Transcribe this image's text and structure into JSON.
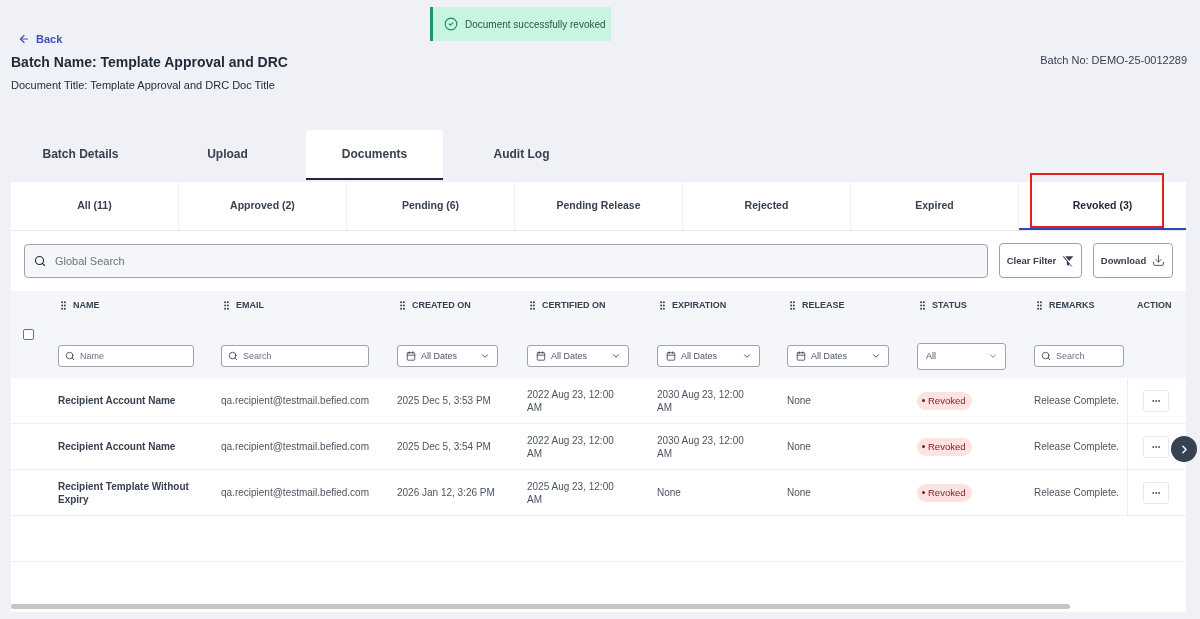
{
  "toast": {
    "message": "Document successfully revoked"
  },
  "header": {
    "back_link": "Back",
    "batch_name": "Batch Name: Template Approval and DRC",
    "document_title": "Document Title: Template Approval and DRC Doc Title",
    "batch_no": "Batch No: DEMO-25-0012289"
  },
  "main_tabs": [
    {
      "label": "Batch Details",
      "selected": false
    },
    {
      "label": "Upload",
      "selected": false
    },
    {
      "label": "Documents",
      "selected": true
    },
    {
      "label": "Audit Log",
      "selected": false
    }
  ],
  "status_tabs": [
    {
      "label": "All (11)",
      "selected": false,
      "outlined": false
    },
    {
      "label": "Approved (2)",
      "selected": false,
      "outlined": false
    },
    {
      "label": "Pending (6)",
      "selected": false,
      "outlined": false
    },
    {
      "label": "Pending Release",
      "selected": false,
      "outlined": false
    },
    {
      "label": "Rejected",
      "selected": false,
      "outlined": false
    },
    {
      "label": "Expired",
      "selected": false,
      "outlined": false
    },
    {
      "label": "Revoked (3)",
      "selected": true,
      "outlined": true
    }
  ],
  "toolbar": {
    "search": {
      "placeholder": "Global Search"
    },
    "buttons": [
      {
        "label": "Clear Filter",
        "kind": "clear_filter"
      },
      {
        "label": "Download",
        "kind": "download"
      }
    ]
  },
  "table": {
    "select_all": {
      "checked": false
    },
    "columns": [
      {
        "label": "NAME",
        "draggable": true,
        "filter": {
          "kind": "search",
          "placeholder": "Name"
        }
      },
      {
        "label": "EMAIL",
        "draggable": true,
        "filter": {
          "kind": "search",
          "placeholder": "Search"
        }
      },
      {
        "label": "CREATED ON",
        "draggable": true,
        "filter": {
          "kind": "date",
          "value": "All Dates"
        }
      },
      {
        "label": "CERTIFIED ON",
        "draggable": true,
        "filter": {
          "kind": "date",
          "value": "All Dates"
        }
      },
      {
        "label": "EXPIRATION",
        "draggable": true,
        "filter": {
          "kind": "date",
          "value": "All Dates"
        }
      },
      {
        "label": "RELEASE",
        "draggable": true,
        "filter": {
          "kind": "date",
          "value": "All Dates"
        }
      },
      {
        "label": "STATUS",
        "draggable": true,
        "filter": {
          "kind": "select",
          "value": "All"
        }
      },
      {
        "label": "REMARKS",
        "draggable": true,
        "filter": {
          "kind": "search",
          "placeholder": "Search"
        }
      },
      {
        "label": "ACTION",
        "draggable": false
      }
    ],
    "rows": [
      {
        "name": "Recipient Account Name",
        "email": "qa.recipient@testmail.befied.com",
        "created_on": "2025 Dec 5, 3:53 PM",
        "certified_on": "2022 Aug 23, 12:00 AM",
        "expiration": "2030 Aug 23, 12:00 AM",
        "release": "None",
        "status": "Revoked",
        "remarks": "Release Complete."
      },
      {
        "name": "Recipient Account Name",
        "email": "qa.recipient@testmail.befied.com",
        "created_on": "2025 Dec 5, 3:54 PM",
        "certified_on": "2022 Aug 23, 12:00 AM",
        "expiration": "2030 Aug 23, 12:00 AM",
        "release": "None",
        "status": "Revoked",
        "remarks": "Release Complete."
      },
      {
        "name": "Recipient Template Without Expiry",
        "email": "qa.recipient@testmail.befied.com",
        "created_on": "2026 Jan 12, 3:26 PM",
        "certified_on": "2025 Aug 23, 12:00 AM",
        "expiration": "None",
        "release": "None",
        "status": "Revoked",
        "remarks": "Release Complete."
      }
    ]
  }
}
